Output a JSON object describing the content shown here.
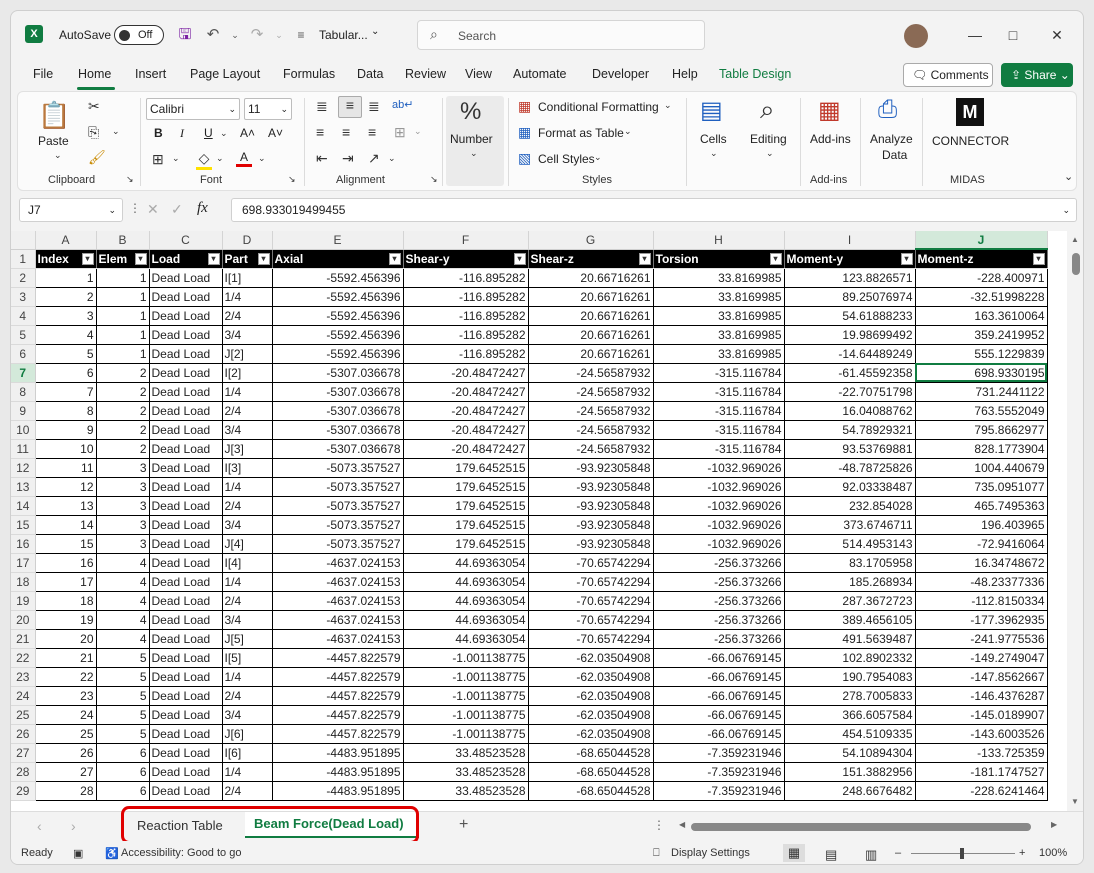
{
  "titlebar": {
    "autosave_label": "AutoSave",
    "autosave_state": "Off",
    "doc_title": "Tabular...",
    "search_placeholder": "Search"
  },
  "menu": {
    "tabs": [
      "File",
      "Home",
      "Insert",
      "Page Layout",
      "Formulas",
      "Data",
      "Review",
      "View",
      "Automate",
      "Developer",
      "Help",
      "Table Design"
    ],
    "comments": "Comments",
    "share": "Share"
  },
  "ribbon": {
    "paste": "Paste",
    "clipboard": "Clipboard",
    "font_name": "Calibri",
    "font_size": "11",
    "font": "Font",
    "alignment": "Alignment",
    "number": "Number",
    "conditional_formatting": "Conditional Formatting",
    "format_as_table": "Format as Table",
    "cell_styles": "Cell Styles",
    "styles": "Styles",
    "cells": "Cells",
    "editing": "Editing",
    "addins": "Add-ins",
    "addins_group": "Add-ins",
    "analyze_data_1": "Analyze",
    "analyze_data_2": "Data",
    "connector": "CONNECTOR",
    "midas": "MIDAS"
  },
  "formula_bar": {
    "cell_ref": "J7",
    "value": "698.933019499455"
  },
  "columns": [
    "A",
    "B",
    "C",
    "D",
    "E",
    "F",
    "G",
    "H",
    "I",
    "J"
  ],
  "headers": [
    "Index",
    "Elem",
    "Load",
    "Part",
    "Axial",
    "Shear-y",
    "Shear-z",
    "Torsion",
    "Moment-y",
    "Moment-z"
  ],
  "rows": [
    [
      "1",
      "1",
      "Dead Load",
      "I[1]",
      "-5592.456396",
      "-116.895282",
      "20.66716261",
      "33.8169985",
      "123.8826571",
      "-228.400971"
    ],
    [
      "2",
      "1",
      "Dead Load",
      "1/4",
      "-5592.456396",
      "-116.895282",
      "20.66716261",
      "33.8169985",
      "89.25076974",
      "-32.51998228"
    ],
    [
      "3",
      "1",
      "Dead Load",
      "2/4",
      "-5592.456396",
      "-116.895282",
      "20.66716261",
      "33.8169985",
      "54.61888233",
      "163.3610064"
    ],
    [
      "4",
      "1",
      "Dead Load",
      "3/4",
      "-5592.456396",
      "-116.895282",
      "20.66716261",
      "33.8169985",
      "19.98699492",
      "359.2419952"
    ],
    [
      "5",
      "1",
      "Dead Load",
      "J[2]",
      "-5592.456396",
      "-116.895282",
      "20.66716261",
      "33.8169985",
      "-14.64489249",
      "555.1229839"
    ],
    [
      "6",
      "2",
      "Dead Load",
      "I[2]",
      "-5307.036678",
      "-20.48472427",
      "-24.56587932",
      "-315.116784",
      "-61.45592358",
      "698.9330195"
    ],
    [
      "7",
      "2",
      "Dead Load",
      "1/4",
      "-5307.036678",
      "-20.48472427",
      "-24.56587932",
      "-315.116784",
      "-22.70751798",
      "731.2441122"
    ],
    [
      "8",
      "2",
      "Dead Load",
      "2/4",
      "-5307.036678",
      "-20.48472427",
      "-24.56587932",
      "-315.116784",
      "16.04088762",
      "763.5552049"
    ],
    [
      "9",
      "2",
      "Dead Load",
      "3/4",
      "-5307.036678",
      "-20.48472427",
      "-24.56587932",
      "-315.116784",
      "54.78929321",
      "795.8662977"
    ],
    [
      "10",
      "2",
      "Dead Load",
      "J[3]",
      "-5307.036678",
      "-20.48472427",
      "-24.56587932",
      "-315.116784",
      "93.53769881",
      "828.1773904"
    ],
    [
      "11",
      "3",
      "Dead Load",
      "I[3]",
      "-5073.357527",
      "179.6452515",
      "-93.92305848",
      "-1032.969026",
      "-48.78725826",
      "1004.440679"
    ],
    [
      "12",
      "3",
      "Dead Load",
      "1/4",
      "-5073.357527",
      "179.6452515",
      "-93.92305848",
      "-1032.969026",
      "92.03338487",
      "735.0951077"
    ],
    [
      "13",
      "3",
      "Dead Load",
      "2/4",
      "-5073.357527",
      "179.6452515",
      "-93.92305848",
      "-1032.969026",
      "232.854028",
      "465.7495363"
    ],
    [
      "14",
      "3",
      "Dead Load",
      "3/4",
      "-5073.357527",
      "179.6452515",
      "-93.92305848",
      "-1032.969026",
      "373.6746711",
      "196.403965"
    ],
    [
      "15",
      "3",
      "Dead Load",
      "J[4]",
      "-5073.357527",
      "179.6452515",
      "-93.92305848",
      "-1032.969026",
      "514.4953143",
      "-72.9416064"
    ],
    [
      "16",
      "4",
      "Dead Load",
      "I[4]",
      "-4637.024153",
      "44.69363054",
      "-70.65742294",
      "-256.373266",
      "83.1705958",
      "16.34748672"
    ],
    [
      "17",
      "4",
      "Dead Load",
      "1/4",
      "-4637.024153",
      "44.69363054",
      "-70.65742294",
      "-256.373266",
      "185.268934",
      "-48.23377336"
    ],
    [
      "18",
      "4",
      "Dead Load",
      "2/4",
      "-4637.024153",
      "44.69363054",
      "-70.65742294",
      "-256.373266",
      "287.3672723",
      "-112.8150334"
    ],
    [
      "19",
      "4",
      "Dead Load",
      "3/4",
      "-4637.024153",
      "44.69363054",
      "-70.65742294",
      "-256.373266",
      "389.4656105",
      "-177.3962935"
    ],
    [
      "20",
      "4",
      "Dead Load",
      "J[5]",
      "-4637.024153",
      "44.69363054",
      "-70.65742294",
      "-256.373266",
      "491.5639487",
      "-241.9775536"
    ],
    [
      "21",
      "5",
      "Dead Load",
      "I[5]",
      "-4457.822579",
      "-1.001138775",
      "-62.03504908",
      "-66.06769145",
      "102.8902332",
      "-149.2749047"
    ],
    [
      "22",
      "5",
      "Dead Load",
      "1/4",
      "-4457.822579",
      "-1.001138775",
      "-62.03504908",
      "-66.06769145",
      "190.7954083",
      "-147.8562667"
    ],
    [
      "23",
      "5",
      "Dead Load",
      "2/4",
      "-4457.822579",
      "-1.001138775",
      "-62.03504908",
      "-66.06769145",
      "278.7005833",
      "-146.4376287"
    ],
    [
      "24",
      "5",
      "Dead Load",
      "3/4",
      "-4457.822579",
      "-1.001138775",
      "-62.03504908",
      "-66.06769145",
      "366.6057584",
      "-145.0189907"
    ],
    [
      "25",
      "5",
      "Dead Load",
      "J[6]",
      "-4457.822579",
      "-1.001138775",
      "-62.03504908",
      "-66.06769145",
      "454.5109335",
      "-143.6003526"
    ],
    [
      "26",
      "6",
      "Dead Load",
      "I[6]",
      "-4483.951895",
      "33.48523528",
      "-68.65044528",
      "-7.359231946",
      "54.10894304",
      "-133.725359"
    ],
    [
      "27",
      "6",
      "Dead Load",
      "1/4",
      "-4483.951895",
      "33.48523528",
      "-68.65044528",
      "-7.359231946",
      "151.3882956",
      "-181.1747527"
    ],
    [
      "28",
      "6",
      "Dead Load",
      "2/4",
      "-4483.951895",
      "33.48523528",
      "-68.65044528",
      "-7.359231946",
      "248.6676482",
      "-228.6241464"
    ]
  ],
  "sheets": {
    "tab1": "Reaction Table",
    "tab2": "Beam Force(Dead Load)"
  },
  "status": {
    "ready": "Ready",
    "accessibility": "Accessibility: Good to go",
    "display_settings": "Display Settings",
    "zoom": "100%"
  },
  "colors": {
    "accent": "#107c41",
    "highlight": "#e00000",
    "header_bg": "#000000"
  }
}
